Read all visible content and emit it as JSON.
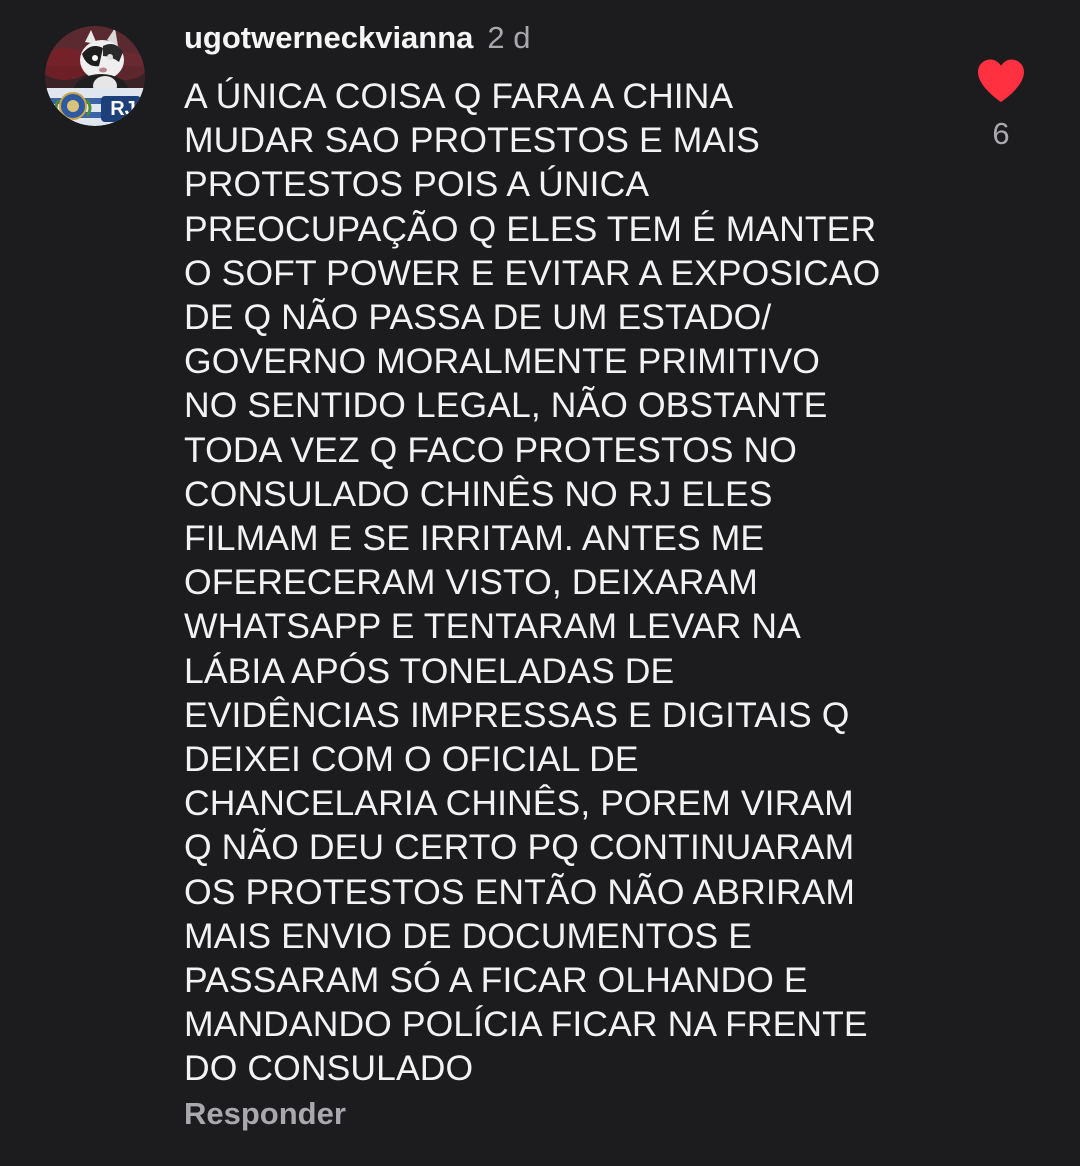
{
  "comment": {
    "username": "ugotwerneckvianna",
    "timestamp": "2 d",
    "avatar_badge": "RJ",
    "text": "A ÚNICA COISA Q FARA A CHINA\nMUDAR SAO PROTESTOS E MAIS\nPROTESTOS POIS A ÚNICA\nPREOCUPAÇÃO Q ELES TEM É MANTER\nO SOFT POWER E EVITAR A EXPOSICAO\nDE Q NÃO PASSA DE UM ESTADO/\nGOVERNO MORALMENTE PRIMITIVO\nNO SENTIDO LEGAL, NÃO OBSTANTE\nTODA VEZ Q FACO PROTESTOS NO\nCONSULADO CHINÊS NO RJ ELES\nFILMAM E SE IRRITAM. ANTES ME\nOFERECERAM VISTO, DEIXARAM\nWHATSAPP E TENTARAM LEVAR NA\nLÁBIA APÓS TONELADAS DE\nEVIDÊNCIAS IMPRESSAS E DIGITAIS Q\nDEIXEI COM O OFICIAL DE\nCHANCELARIA CHINÊS, POREM VIRAM\nQ NÃO DEU CERTO PQ CONTINUARAM\nOS PROTESTOS ENTÃO NÃO ABRIRAM\nMAIS ENVIO DE DOCUMENTOS E\nPASSARAM SÓ A FICAR OLHANDO E\nMANDANDO POLÍCIA FICAR NA FRENTE\nDO CONSULADO",
    "reply_label": "Responder",
    "like_count": "6",
    "like_icon": "heart-icon",
    "colors": {
      "background": "#1c1c1e",
      "text": "#f2f2f2",
      "muted": "#a8a8ad",
      "heart": "#ff3040"
    }
  }
}
